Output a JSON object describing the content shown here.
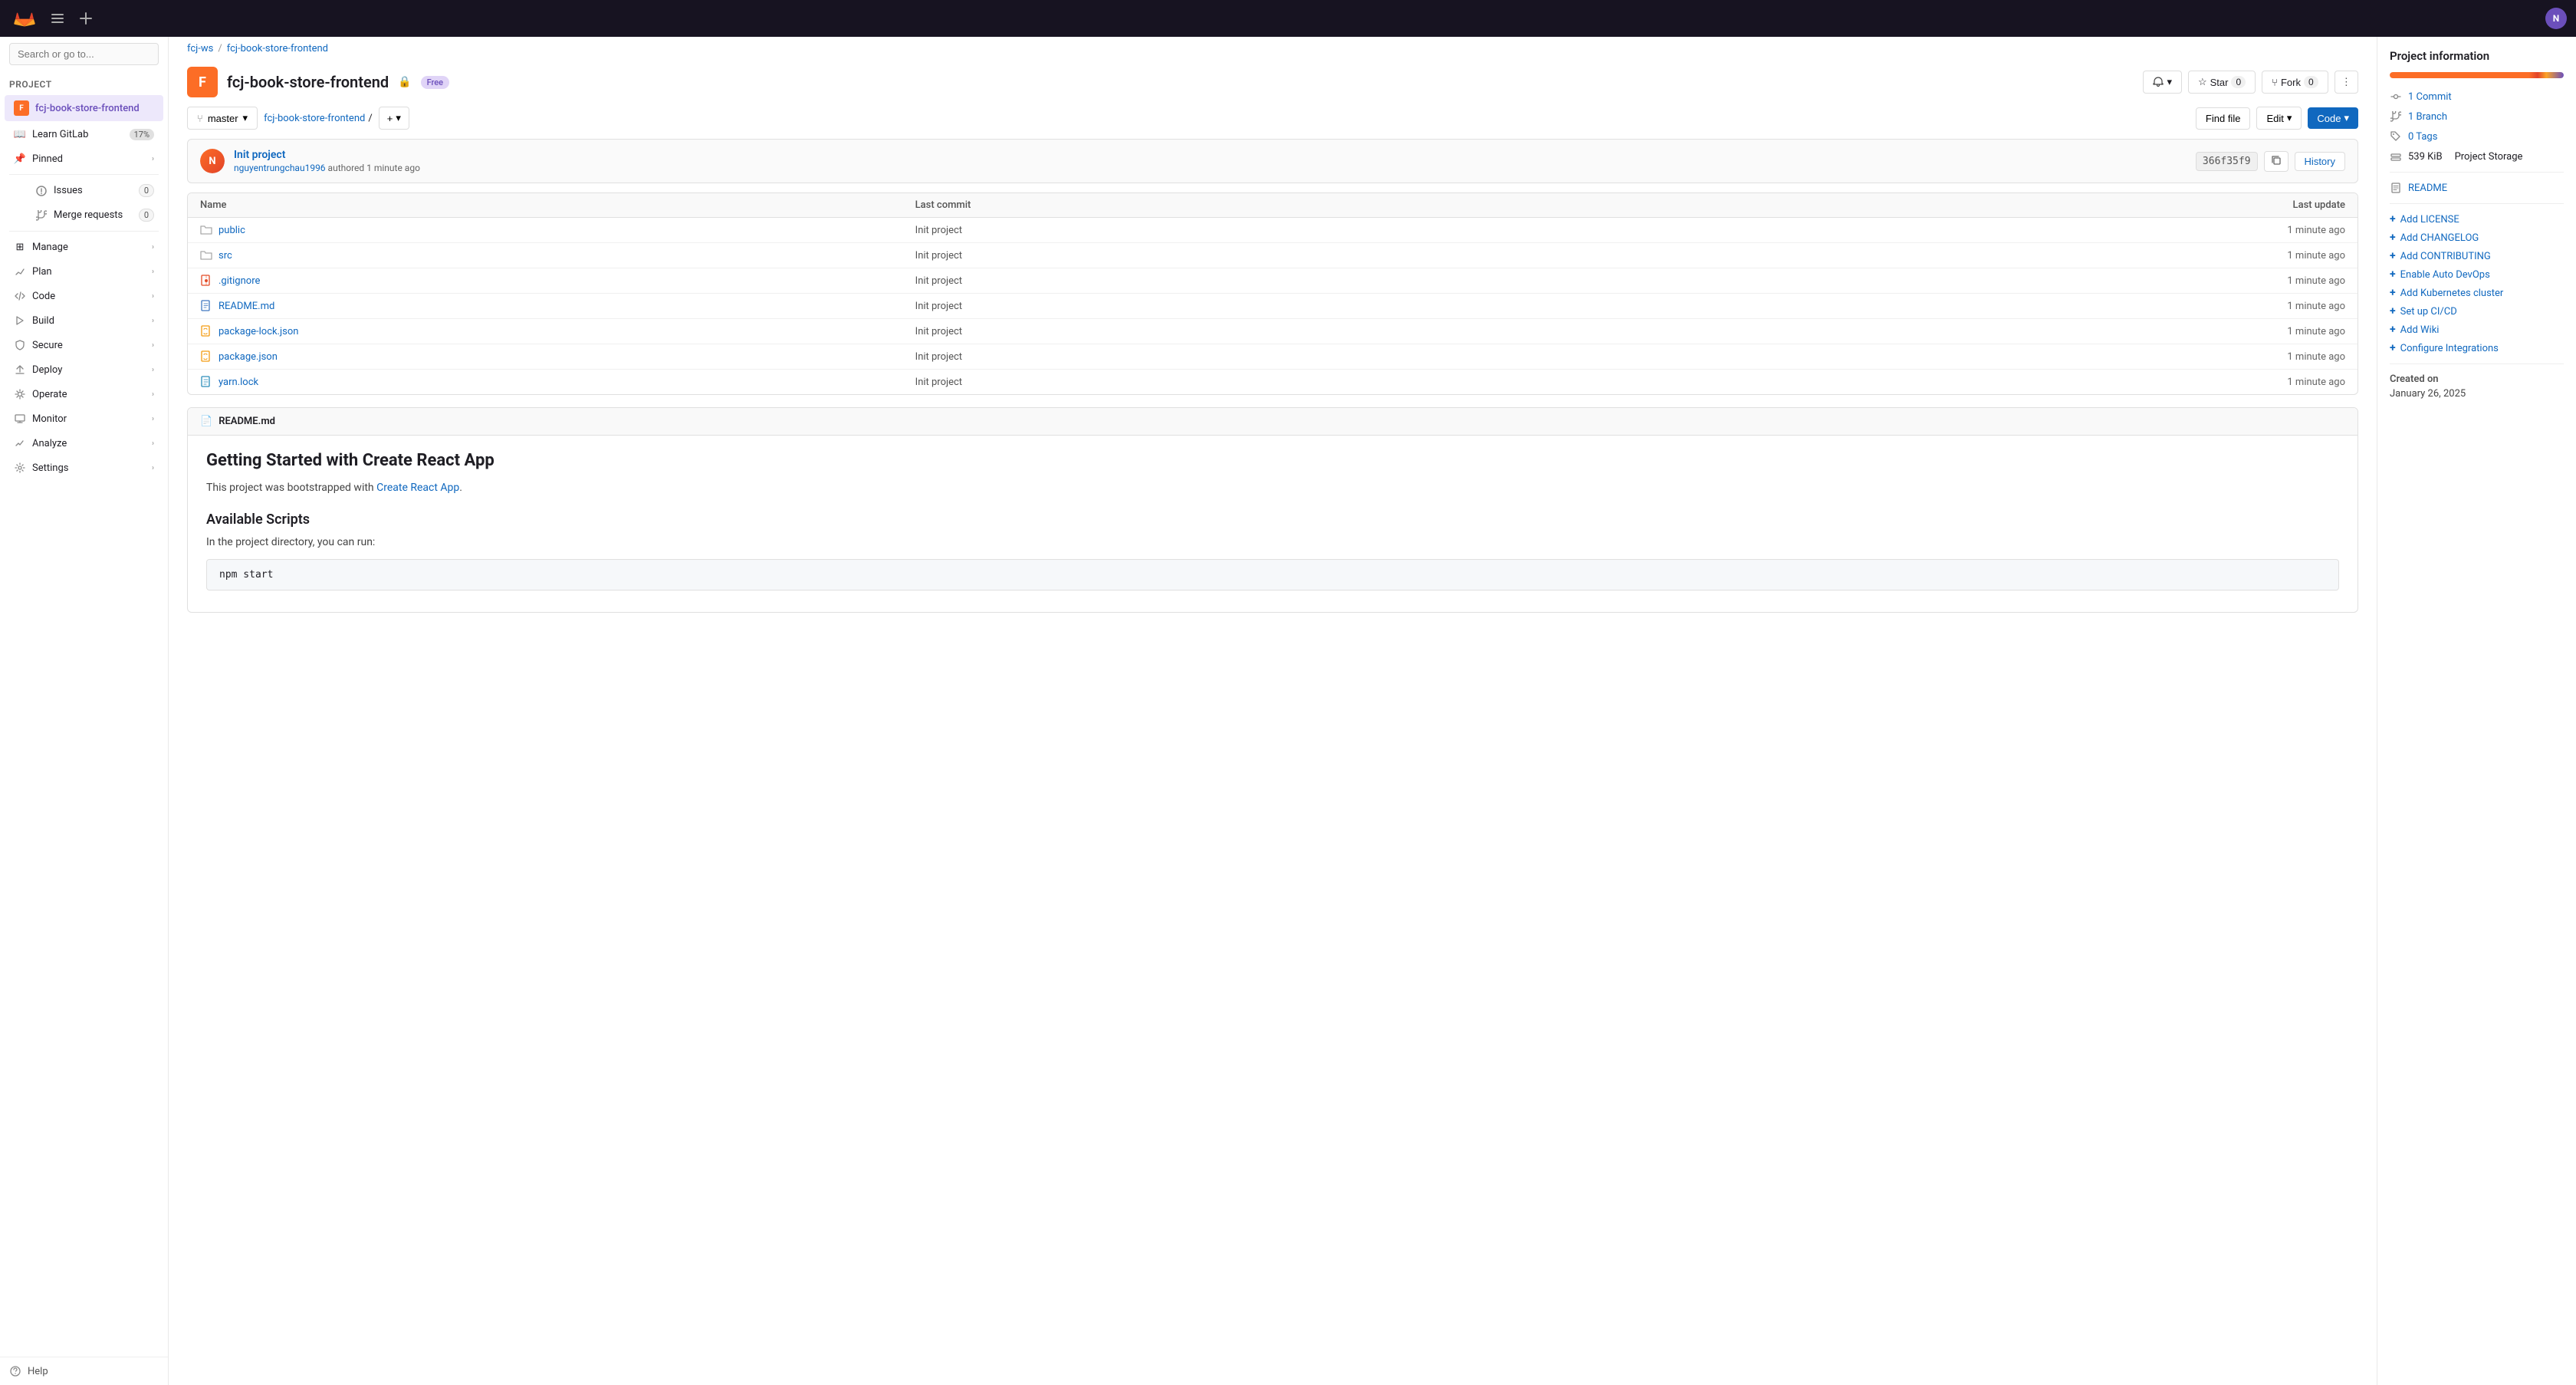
{
  "topNav": {
    "logo_alt": "GitLab",
    "sidebar_toggle_title": "Toggle sidebar",
    "new_btn_title": "New",
    "user_avatar_initials": "N"
  },
  "breadcrumb": {
    "workspace": "fcj-ws",
    "project": "fcj-book-store-frontend"
  },
  "project": {
    "avatar_letter": "F",
    "name": "fcj-book-store-frontend",
    "badge": "Free",
    "star_label": "Star",
    "star_count": "0",
    "fork_label": "Fork",
    "fork_count": "0"
  },
  "repoControls": {
    "branch_icon": "⑂",
    "branch_name": "master",
    "path_root": "fcj-book-store-frontend",
    "path_sep": "/",
    "add_btn": "+",
    "find_file_label": "Find file",
    "edit_label": "Edit",
    "edit_chevron": "▾",
    "code_label": "Code",
    "code_chevron": "▾"
  },
  "commitInfo": {
    "avatar_initials": "N",
    "message": "Init project",
    "author": "nguyentrungchau1996",
    "authored": "authored",
    "time": "1 minute ago",
    "hash": "366f35f9",
    "copy_title": "Copy commit SHA",
    "history_label": "History"
  },
  "fileTableHeaders": {
    "name": "Name",
    "last_commit": "Last commit",
    "last_update": "Last update"
  },
  "files": [
    {
      "icon": "folder",
      "name": "public",
      "commit": "Init project",
      "time": "1 minute ago"
    },
    {
      "icon": "folder",
      "name": "src",
      "commit": "Init project",
      "time": "1 minute ago"
    },
    {
      "icon": "gitignore",
      "name": ".gitignore",
      "commit": "Init project",
      "time": "1 minute ago"
    },
    {
      "icon": "readme",
      "name": "README.md",
      "commit": "Init project",
      "time": "1 minute ago"
    },
    {
      "icon": "json",
      "name": "package-lock.json",
      "commit": "Init project",
      "time": "1 minute ago"
    },
    {
      "icon": "json",
      "name": "package.json",
      "commit": "Init project",
      "time": "1 minute ago"
    },
    {
      "icon": "yarn",
      "name": "yarn.lock",
      "commit": "Init project",
      "time": "1 minute ago"
    }
  ],
  "readme": {
    "header_icon": "📄",
    "filename": "README.md",
    "title": "Getting Started with Create React App",
    "intro": "This project was bootstrapped with",
    "link_text": "Create React App",
    "link_href": "#",
    "scripts_title": "Available Scripts",
    "scripts_intro": "In the project directory, you can run:",
    "npm_start": "npm start"
  },
  "sidebar": {
    "search_placeholder": "Search or go to...",
    "project_label": "Project",
    "nav_items": [
      {
        "id": "project",
        "label": "fcj-book-store-frontend",
        "icon": "F",
        "active": true
      },
      {
        "id": "learn",
        "label": "Learn GitLab",
        "badge": "17%",
        "icon": "📖"
      }
    ],
    "pinned_label": "Pinned",
    "pinned_icon": "📌",
    "issues_label": "Issues",
    "issues_count": "0",
    "merge_requests_label": "Merge requests",
    "merge_requests_count": "0",
    "menu_items": [
      {
        "id": "manage",
        "label": "Manage",
        "icon": "⊞"
      },
      {
        "id": "plan",
        "label": "Plan",
        "icon": "◈"
      },
      {
        "id": "code",
        "label": "Code",
        "icon": "⟨⟩"
      },
      {
        "id": "build",
        "label": "Build",
        "icon": "▶"
      },
      {
        "id": "secure",
        "label": "Secure",
        "icon": "🔒"
      },
      {
        "id": "deploy",
        "label": "Deploy",
        "icon": "↑"
      },
      {
        "id": "operate",
        "label": "Operate",
        "icon": "⚙"
      },
      {
        "id": "monitor",
        "label": "Monitor",
        "icon": "📊"
      },
      {
        "id": "analyze",
        "label": "Analyze",
        "icon": "📈"
      },
      {
        "id": "settings",
        "label": "Settings",
        "icon": "⚙"
      }
    ],
    "help_label": "Help"
  },
  "projectInfo": {
    "title": "Project information",
    "commits_count": "1",
    "commits_label": "Commit",
    "branches_count": "1",
    "branches_label": "Branch",
    "tags_count": "0",
    "tags_label": "Tags",
    "storage_size": "539 KiB",
    "storage_label": "Project Storage",
    "readme_label": "README",
    "add_license": "Add LICENSE",
    "add_changelog": "Add CHANGELOG",
    "add_contributing": "Add CONTRIBUTING",
    "enable_autodevops": "Enable Auto DevOps",
    "add_kubernetes": "Add Kubernetes cluster",
    "setup_cicd": "Set up CI/CD",
    "add_wiki": "Add Wiki",
    "configure_integrations": "Configure Integrations",
    "created_label": "Created on",
    "created_date": "January 26, 2025"
  }
}
